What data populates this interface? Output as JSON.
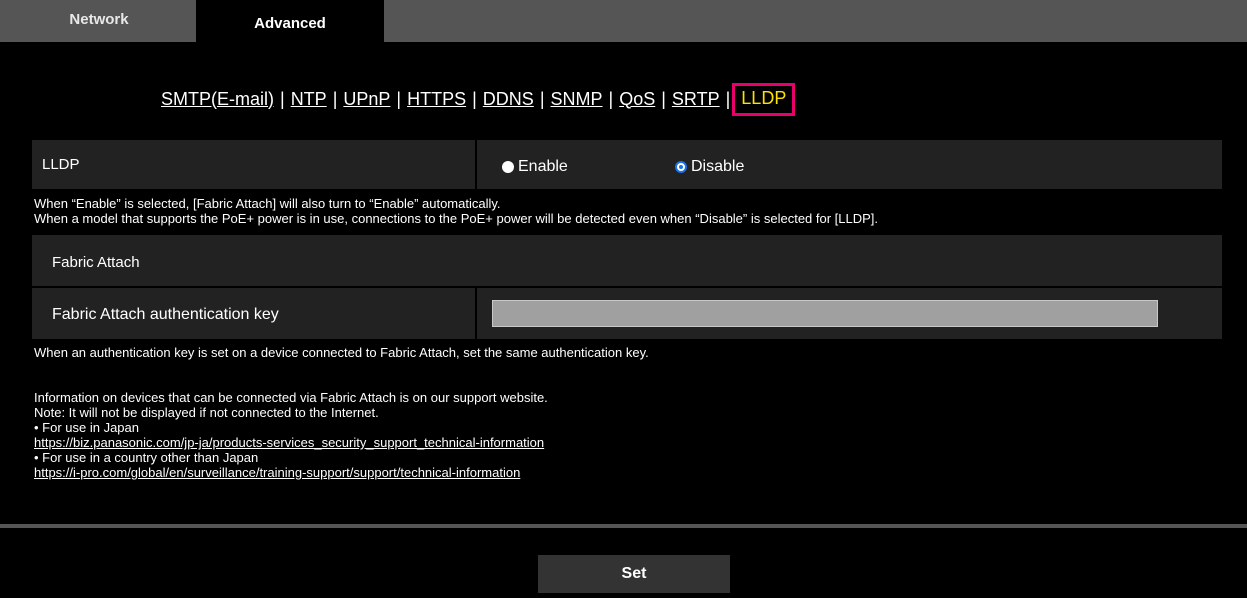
{
  "tabs": [
    {
      "label": "Network",
      "active": false
    },
    {
      "label": "Advanced",
      "active": true
    }
  ],
  "submenu": {
    "items": [
      "SMTP(E-mail)",
      "NTP",
      "UPnP",
      "HTTPS",
      "DDNS",
      "SNMP",
      "QoS",
      "SRTP"
    ],
    "current": "LLDP",
    "separator": "|"
  },
  "lldp": {
    "label": "LLDP",
    "options": [
      "Enable",
      "Disable"
    ],
    "selected": "Disable"
  },
  "notes": {
    "line1": "When “Enable” is selected, [Fabric Attach] will also turn to “Enable” automatically.",
    "line2": "When a model that supports the PoE+ power is in use, connections to the PoE+ power will be detected even when “Disable” is selected for [LLDP].",
    "line3": "When an authentication key is set on a device connected to Fabric Attach, set the same authentication key."
  },
  "fabric_attach": {
    "label": "Fabric Attach",
    "key_label": "Fabric Attach authentication key",
    "key_value": ""
  },
  "info": {
    "line1": "Information on devices that can be connected via Fabric Attach is on our support website.",
    "line2": "Note: It will not be displayed if not connected to the Internet.",
    "japan_label": "• For use in Japan",
    "japan_url": "https://biz.panasonic.com/jp-ja/products-services_security_support_technical-information",
    "other_label": "• For use in a country other than Japan",
    "other_url": "https://i-pro.com/global/en/surveillance/training-support/support/technical-information"
  },
  "actions": {
    "set_label": "Set"
  },
  "colors": {
    "highlight_border": "#e8006c",
    "current_text": "#ffe000",
    "radio_accent": "#1a73e8"
  }
}
